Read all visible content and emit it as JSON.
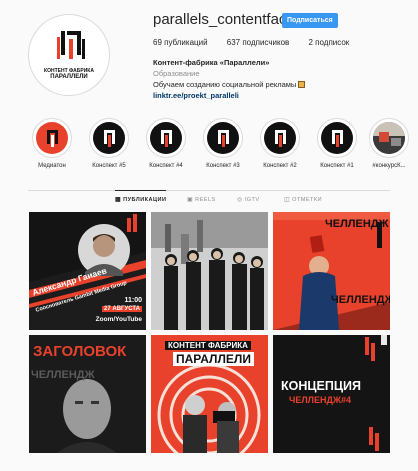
{
  "profile": {
    "username": "parallels_contentfactory",
    "follow_label": "Подписаться",
    "stats": {
      "posts": "69 публикаций",
      "followers": "637 подписчиков",
      "following": "2 подписок"
    },
    "avatar_text_1": "КОНТЕНТ ФАБРИКА",
    "avatar_text_2": "ПАРАЛЛЕЛИ",
    "bio": {
      "name": "Контент-фабрика «Параллели»",
      "category": "Образование",
      "text": "Обучаем созданию социальной рекламы",
      "link": "linktr.ee/proekt_paralleli"
    }
  },
  "highlights": [
    {
      "label": "Медиатон",
      "style": "orange"
    },
    {
      "label": "Конспект #5",
      "style": "black"
    },
    {
      "label": "Конспект #4",
      "style": "black"
    },
    {
      "label": "Конспект #3",
      "style": "black"
    },
    {
      "label": "Конспект #2",
      "style": "black"
    },
    {
      "label": "Конспект #1",
      "style": "black"
    },
    {
      "label": "#конкурсК...",
      "style": "photo"
    }
  ],
  "tabs": [
    {
      "label": "ПУБЛИКАЦИИ",
      "icon": "grid-icon",
      "active": true
    },
    {
      "label": "REELS",
      "icon": "reels-icon",
      "active": false
    },
    {
      "label": "IGTV",
      "icon": "igtv-icon",
      "active": false
    },
    {
      "label": "ОТМЕТКИ",
      "icon": "tag-icon",
      "active": false
    }
  ],
  "posts": {
    "p1": {
      "name": "Александр Гаиаев",
      "company": "Сооснователь Gambit Media Group",
      "time": "11:00",
      "date": "27 АВГУСТА",
      "platform": "Zoom/YouTube"
    },
    "p3": {
      "side_text": "ЧЕЛЛЕНДЖ"
    },
    "p4": {
      "title": "ЗАГОЛОВОК",
      "side_text": "ЧЕЛЛЕНДЖ"
    },
    "p5": {
      "title_1": "КОНТЕНТ ФАБРИКА",
      "title_2": "ПАРАЛЛЕЛИ"
    },
    "p6": {
      "title": "КОНЦЕПЦИЯ",
      "subtitle": "ЧЕЛЛЕНДЖ#4"
    }
  },
  "colors": {
    "accent_orange": "#e8412c",
    "follow_blue": "#3897f0",
    "dark": "#111111"
  }
}
